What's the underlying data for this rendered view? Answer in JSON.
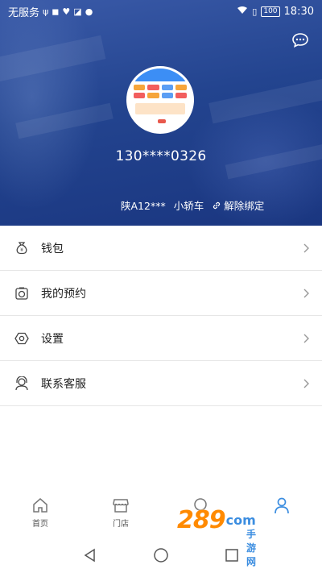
{
  "status_bar": {
    "carrier": "无服务",
    "battery": "100",
    "time": "18:30"
  },
  "profile": {
    "phone": "130****0326",
    "plate": "陕A12***",
    "car_type": "小轿车",
    "unbind_label": "解除绑定"
  },
  "menu": [
    {
      "label": "钱包",
      "icon": "wallet-icon"
    },
    {
      "label": "我的预约",
      "icon": "camera-icon"
    },
    {
      "label": "设置",
      "icon": "settings-icon"
    },
    {
      "label": "联系客服",
      "icon": "customer-service-icon"
    }
  ],
  "bottom_nav": [
    {
      "label": "首页",
      "icon": "home-icon"
    },
    {
      "label": "门店",
      "icon": "store-icon"
    },
    {
      "label": "",
      "icon": "search-icon"
    },
    {
      "label": "",
      "icon": "user-icon",
      "active": true
    }
  ],
  "watermark": {
    "main": "289",
    "suffix": "com",
    "sub": "手游网"
  },
  "colors": {
    "header_blue": "#23448f",
    "accent_blue": "#3b8de0",
    "watermark_orange": "#ff8a00"
  }
}
